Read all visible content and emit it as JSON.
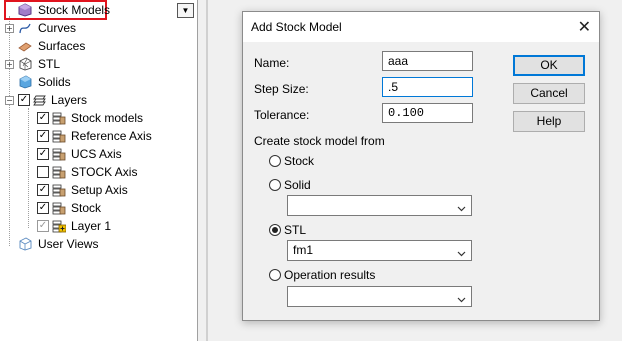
{
  "tree": {
    "dropdown_glyph": "▼",
    "items": [
      {
        "label": "Stock Models",
        "icon": "stock-models-icon"
      },
      {
        "label": "Curves",
        "icon": "curves-icon"
      },
      {
        "label": "Surfaces",
        "icon": "surfaces-icon"
      },
      {
        "label": "STL",
        "icon": "stl-icon"
      },
      {
        "label": "Solids",
        "icon": "solids-icon"
      },
      {
        "label": "Layers",
        "icon": "layers-icon"
      },
      {
        "label": "Stock models",
        "icon": "layer-icon",
        "checked": true
      },
      {
        "label": "Reference Axis",
        "icon": "layer-icon",
        "checked": true
      },
      {
        "label": "UCS Axis",
        "icon": "layer-icon",
        "checked": true
      },
      {
        "label": "STOCK Axis",
        "icon": "layer-icon",
        "checked": false
      },
      {
        "label": "Setup Axis",
        "icon": "layer-icon",
        "checked": true
      },
      {
        "label": "Stock",
        "icon": "layer-icon",
        "checked": true
      },
      {
        "label": "Layer 1",
        "icon": "active-layer-icon",
        "checked": true
      },
      {
        "label": "User Views",
        "icon": "user-views-icon"
      }
    ]
  },
  "dialog": {
    "title": "Add Stock Model",
    "close_glyph": "✕",
    "name_label": "Name:",
    "name_value": "aaa",
    "step_label": "Step Size:",
    "step_value": ".5",
    "tolerance_label": "Tolerance:",
    "tolerance_value": "0.100",
    "group_label": "Create stock model from",
    "options": [
      {
        "label": "Stock",
        "selected": false
      },
      {
        "label": "Solid",
        "selected": false
      },
      {
        "label": "STL",
        "selected": true
      },
      {
        "label": "Operation results",
        "selected": false
      }
    ],
    "solid_combo_value": "",
    "stl_combo_value": "fm1",
    "op_combo_value": "",
    "ok_label": "OK",
    "cancel_label": "Cancel",
    "help_label": "Help"
  },
  "colors": {
    "highlight": "#e0141e",
    "focus": "#0078d7"
  }
}
